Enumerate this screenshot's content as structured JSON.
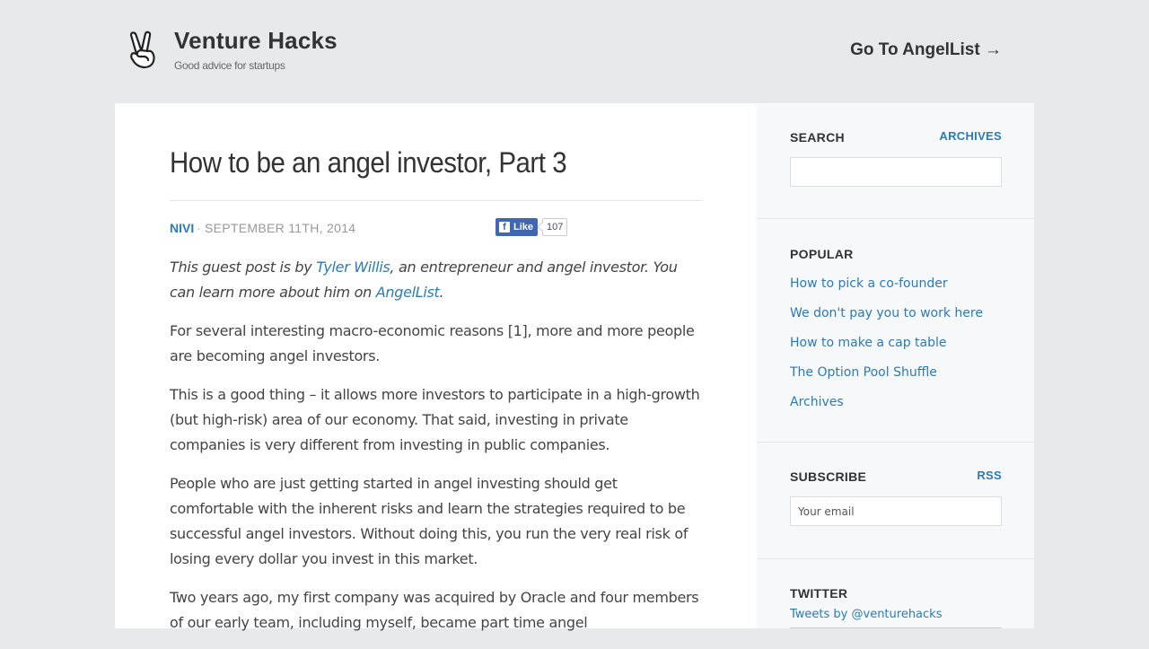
{
  "header": {
    "logo_icon": "victory-hand-icon",
    "site_title": "Venture Hacks",
    "tagline": "Good advice for startups",
    "angellist_link": "Go To AngelList →"
  },
  "post": {
    "title": "How to be an angel investor, Part 3",
    "author": "NIVI",
    "meta_separator": "·",
    "date": "SEPTEMBER 11TH, 2014",
    "facebook": {
      "like_label": "Like",
      "icon": "facebook-f-icon",
      "count": "107"
    },
    "intro": {
      "prefix": "This guest post is by ",
      "author_link": "Tyler Willis",
      "middle": ", an entrepreneur and angel investor. You can learn more about him on ",
      "angellist_link": "AngelList",
      "suffix": "."
    },
    "paragraphs": [
      "For several interesting macro-economic reasons [1], more and more people are becoming angel investors.",
      "This is a good thing – it allows more investors to participate in a high-growth (but high-risk) area of our economy. That said, investing in private companies is very different from investing in public companies.",
      "People who are just getting started in angel investing should get comfortable with the inherent risks and learn the strategies required to be successful angel investors. Without doing this, you run the very real risk of losing every dollar you invest in this market.",
      "Two years ago, my first company was acquired by Oracle and four members of our early team, including myself, became part time angel"
    ]
  },
  "sidebar": {
    "search": {
      "heading": "SEARCH",
      "archives_link": "ARCHIVES",
      "value": ""
    },
    "popular": {
      "heading": "POPULAR",
      "items": [
        "How to pick a co-founder",
        "We don't pay you to work here",
        "How to make a cap table",
        "The Option Pool Shuffle",
        "Archives"
      ]
    },
    "subscribe": {
      "heading": "SUBSCRIBE",
      "rss_link": "RSS",
      "placeholder": "Your email"
    },
    "twitter": {
      "heading": "TWITTER",
      "tweets_link": "Tweets by @venturehacks"
    }
  },
  "colors": {
    "accent": "#2b7bb9",
    "background": "#e8e9ea",
    "sidebar": "#f7f8f9",
    "facebook": "#4267b2"
  }
}
